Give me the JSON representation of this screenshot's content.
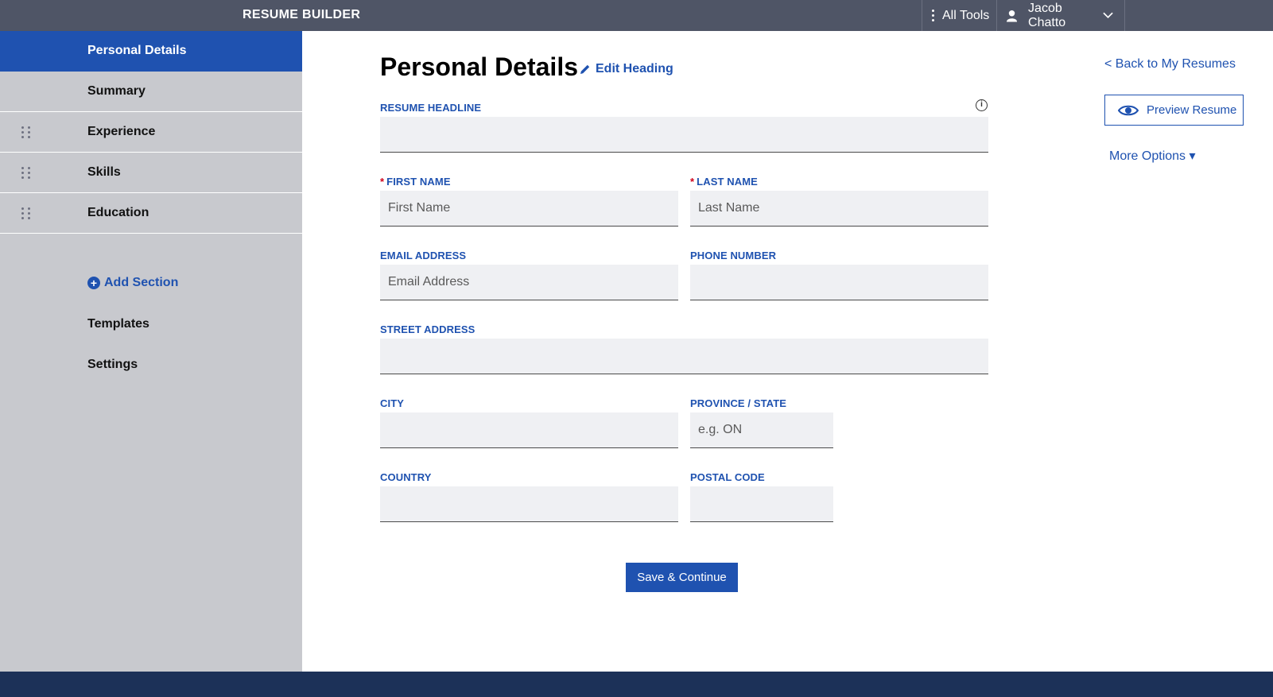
{
  "header": {
    "brand": "RESUME BUILDER",
    "all_tools": "All Tools",
    "user_name": "Jacob Chatto"
  },
  "sidebar": {
    "items": [
      {
        "label": "Personal Details",
        "active": true
      },
      {
        "label": "Summary"
      },
      {
        "label": "Experience"
      },
      {
        "label": "Skills"
      },
      {
        "label": "Education"
      }
    ],
    "add_section": "Add Section",
    "templates": "Templates",
    "settings": "Settings"
  },
  "main": {
    "title": "Personal Details",
    "edit_heading": "Edit Heading",
    "fields": {
      "headline": {
        "label": "RESUME HEADLINE",
        "value": "",
        "placeholder": ""
      },
      "first_name": {
        "label": "FIRST NAME",
        "required": "*",
        "placeholder": "First Name"
      },
      "last_name": {
        "label": "LAST NAME",
        "required": "*",
        "placeholder": "Last Name"
      },
      "email": {
        "label": "EMAIL ADDRESS",
        "placeholder": "Email Address"
      },
      "phone": {
        "label": "PHONE NUMBER",
        "placeholder": ""
      },
      "street": {
        "label": "STREET ADDRESS",
        "placeholder": ""
      },
      "city": {
        "label": "CITY",
        "placeholder": ""
      },
      "province": {
        "label": "PROVINCE / STATE",
        "placeholder": "e.g. ON"
      },
      "country": {
        "label": "COUNTRY",
        "placeholder": ""
      },
      "postal": {
        "label": "POSTAL CODE",
        "placeholder": ""
      }
    },
    "save_button": "Save & Continue"
  },
  "right": {
    "back_link": "< Back to My Resumes",
    "preview": "Preview Resume",
    "more_options": "More Options ▾"
  },
  "colors": {
    "topbar": "#4f5566",
    "accent": "#1f52b0",
    "sidebar": "#c8c9ce",
    "footer": "#1c3158",
    "field_bg": "#eff0f3",
    "required": "#d0021b"
  },
  "icons": [
    "kebab-icon",
    "user-icon",
    "chevron-down-icon",
    "drag-handle-icon",
    "plus-circle-icon",
    "pencil-icon",
    "info-icon",
    "eye-icon"
  ]
}
